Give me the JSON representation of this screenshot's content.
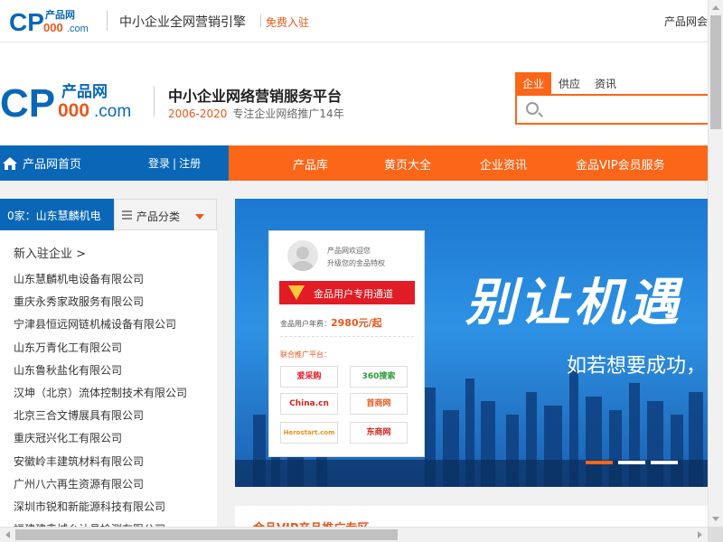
{
  "topbar": {
    "logo_cp": "CP",
    "logo_cn": "产品网",
    "logo_num": "000",
    "logo_com": ".com",
    "slogan": "中小企业全网营销引擎",
    "free_join": "免费入驻",
    "right_link": "产品网会"
  },
  "header": {
    "logo_cp": "CP",
    "logo_cn": "产品网",
    "logo_num": "000",
    "logo_com": ".com",
    "title": "中小企业网络营销服务平台",
    "years": "2006-2020",
    "subtitle": "专注企业网络推广14年"
  },
  "search": {
    "tabs": [
      "企业",
      "供应",
      "资讯"
    ],
    "active_tab": 0,
    "placeholder": ""
  },
  "nav": {
    "home": "产品网首页",
    "login": "登录",
    "divider": "|",
    "register": "注册",
    "items": [
      "产品库",
      "黄页大全",
      "企业资讯",
      "金品VIP会员服务"
    ]
  },
  "sidebar": {
    "ticker": "0家：山东慧麟机电",
    "category": "产品分类",
    "new_title": "新入驻企业 >",
    "companies": [
      "山东慧麟机电设备有限公司",
      "重庆永秀家政服务有限公司",
      "宁津县恒远网链机械设备有限公司",
      "山东万青化工有限公司",
      "山东鲁秋盐化有限公司",
      "汉坤（北京）流体控制技术有限公司",
      "北京三合文博展具有限公司",
      "重庆冠兴化工有限公司",
      "安徽岭丰建筑材料有限公司",
      "广州八六再生资源有限公司",
      "深圳市锐和新能源科技有限公司",
      "福建建鑫城乡认具检测有限公司"
    ]
  },
  "banner": {
    "headline": "别让机遇",
    "subline": "如若想要成功，",
    "card": {
      "welcome": "产品网欢迎您",
      "upgrade": "升级您的金品特权",
      "gold_button": "金品用户专用通道",
      "fee_label": "金品用户年费：",
      "fee_value": "2980元/起",
      "union_label": "联合推广平台：",
      "partners": [
        "爱采购",
        "360搜索",
        "China.cn",
        "首商网",
        "Herostart.com",
        "东商网"
      ]
    }
  },
  "below": {
    "title": "金品VIP产品推广专区"
  },
  "colors": {
    "orange": "#fc6618",
    "blue": "#0a67b7",
    "red": "#e21c24"
  }
}
